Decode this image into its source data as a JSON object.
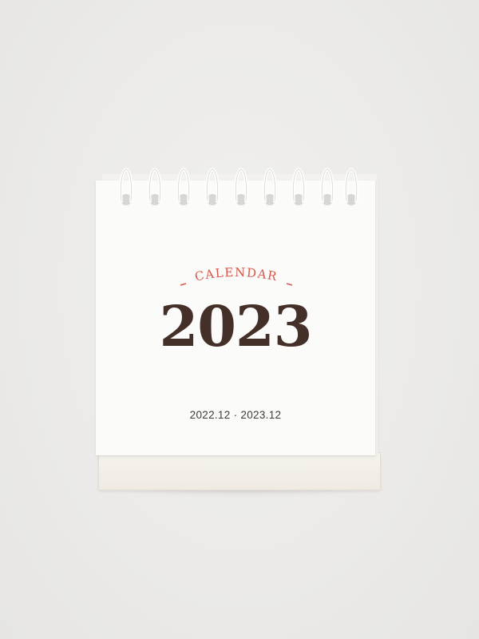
{
  "calendar": {
    "label": "CALENDAR",
    "year": "2023",
    "date_range": "2022.12 · 2023.12"
  },
  "colors": {
    "background": "#ecebea",
    "label_red": "#d9574d",
    "year_brown": "#443028",
    "page_white": "#fbfbf9"
  }
}
